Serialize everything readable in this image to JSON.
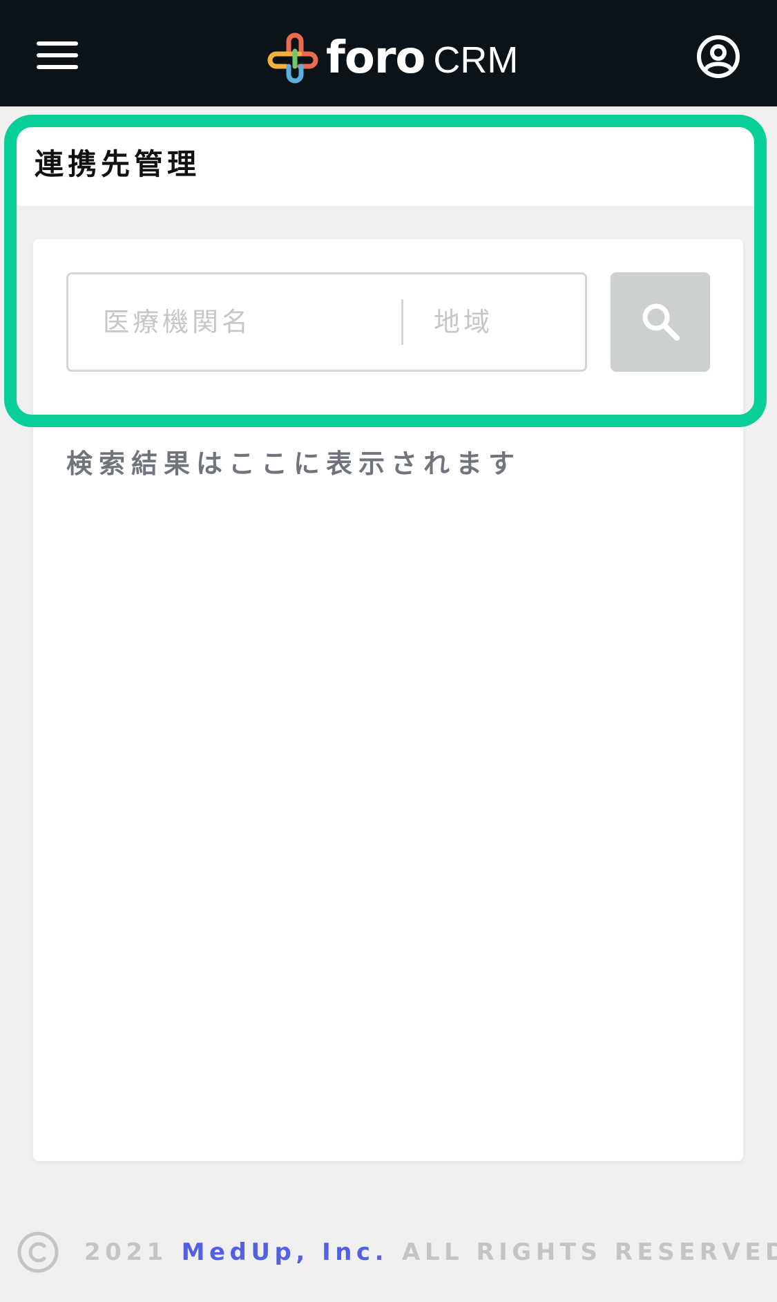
{
  "header": {
    "brand_name": "foro",
    "brand_suffix": "CRM",
    "menu_icon": "hamburger-menu-icon",
    "account_icon": "user-circle-icon",
    "background_color": "#0b1319"
  },
  "page": {
    "title": "連携先管理"
  },
  "search": {
    "facility_placeholder": "医療機関名",
    "area_placeholder": "地域",
    "button_icon": "search-icon",
    "button_color": "#ccd0d1"
  },
  "results": {
    "empty_message": "検索結果はここに表示されます"
  },
  "highlight": {
    "color": "#07cf97"
  },
  "footer": {
    "year": "2021",
    "company": "MedUp, Inc.",
    "rights": "ALL RIGHTS RESERVED.",
    "company_color": "#5460e4"
  }
}
